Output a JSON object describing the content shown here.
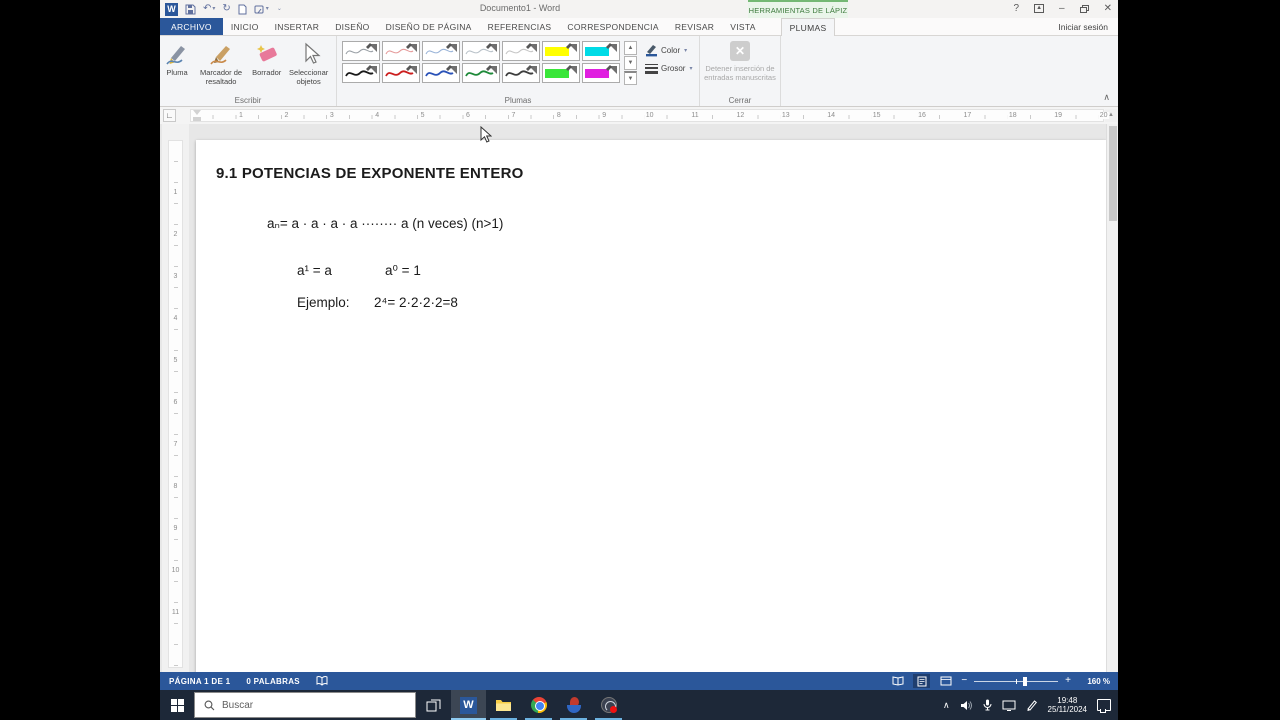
{
  "colors": {
    "accent": "#2b579a",
    "context_green": "#74b874",
    "taskbar": "#1d2838",
    "status_bar": "#2b579a"
  },
  "window": {
    "title": "Documento1 - Word",
    "context_header": "HERRAMIENTAS DE LÁPIZ",
    "sign_in": "Iniciar sesión",
    "help": "?"
  },
  "tabs": {
    "file": "ARCHIVO",
    "items": [
      "INICIO",
      "INSERTAR",
      "DISEÑO",
      "DISEÑO DE PÁGINA",
      "REFERENCIAS",
      "CORRESPONDENCIA",
      "REVISAR",
      "VISTA"
    ],
    "active": "PLUMAS"
  },
  "ribbon": {
    "escribir": {
      "label": "Escribir",
      "pen": "Pluma",
      "highlighter": "Marcador de resaltado",
      "eraser": "Borrador",
      "select": "Seleccionar objetos"
    },
    "plumas": {
      "label": "Plumas",
      "color": "Color",
      "thickness": "Grosor",
      "gallery": [
        {
          "kind": "pen",
          "color": "#9aa0a6",
          "w": 1.1
        },
        {
          "kind": "pen",
          "color": "#e59b9b",
          "w": 1.1
        },
        {
          "kind": "pen",
          "color": "#9ab4d8",
          "w": 1.1
        },
        {
          "kind": "pen",
          "color": "#b9c2c9",
          "w": 1.1
        },
        {
          "kind": "pen",
          "color": "#c6c6c6",
          "w": 1.1
        },
        {
          "kind": "highlighter",
          "color": "#ffff00"
        },
        {
          "kind": "highlighter",
          "color": "#00dbe6"
        },
        {
          "kind": "pen",
          "color": "#1a1a1a",
          "w": 1.8
        },
        {
          "kind": "pen",
          "color": "#cc1f1f",
          "w": 1.8
        },
        {
          "kind": "pen",
          "color": "#2a52b8",
          "w": 1.8
        },
        {
          "kind": "pen",
          "color": "#1f8a3a",
          "w": 1.8
        },
        {
          "kind": "pen",
          "color": "#3d3d3d",
          "w": 1.8
        },
        {
          "kind": "highlighter",
          "color": "#39e639"
        },
        {
          "kind": "highlighter",
          "color": "#e01fe0"
        }
      ]
    },
    "cerrar": {
      "label": "Cerrar",
      "stop": "Detener inserción de entradas manuscritas"
    }
  },
  "ruler": {
    "h_count": 20,
    "v_count": 11
  },
  "document": {
    "heading": "9.1 POTENCIAS DE EXPONENTE ENTERO",
    "line1": "aₙ= a · a · a · a ········ a (n veces) (n>1)",
    "line2a": "a¹ = a",
    "line2b": "a⁰ = 1",
    "line3_label": "Ejemplo:",
    "line3_formula": "2⁴= 2·2·2·2=8"
  },
  "status": {
    "page": "PÁGINA 1 DE 1",
    "words": "0 PALABRAS",
    "zoom": "160 %"
  },
  "taskbar": {
    "search": "Buscar",
    "time": "19:48",
    "date": "25/11/2024"
  }
}
